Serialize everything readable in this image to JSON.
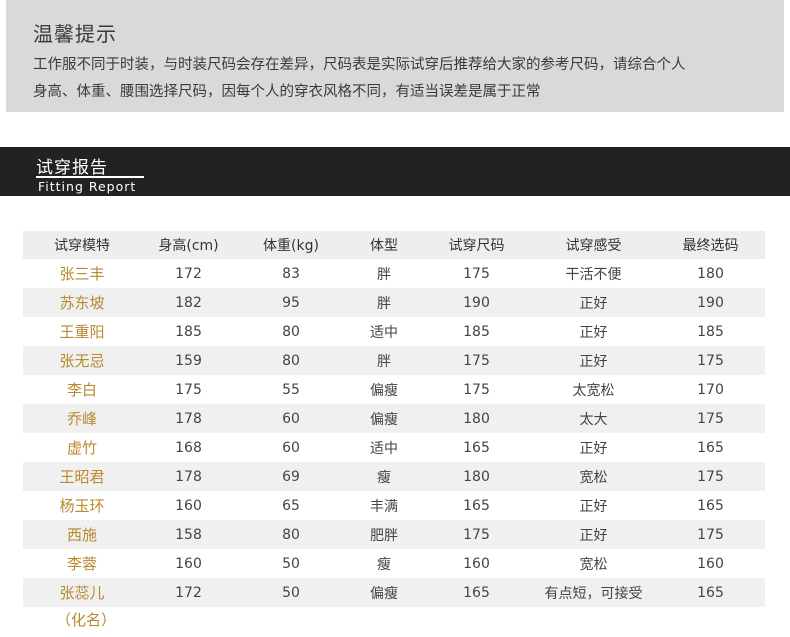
{
  "notice": {
    "title": "温馨提示",
    "line1": "工作服不同于时装，与时装尺码会存在差异，尺码表是实际试穿后推荐给大家的参考尺码，请综合个人",
    "line2": "身高、体重、腰围选择尺码，因每个人的穿衣风格不同，有适当误差是属于正常"
  },
  "banner": {
    "title_cn": "试穿报告",
    "title_en": "Fitting Report"
  },
  "table": {
    "headers": [
      "试穿模特",
      "身高(cm)",
      "体重(kg)",
      "体型",
      "试穿尺码",
      "试穿感受",
      "最终选码"
    ],
    "rows": [
      [
        "张三丰",
        "172",
        "83",
        "胖",
        "175",
        "干活不便",
        "180"
      ],
      [
        "苏东坡",
        "182",
        "95",
        "胖",
        "190",
        "正好",
        "190"
      ],
      [
        "王重阳",
        "185",
        "80",
        "适中",
        "185",
        "正好",
        "185"
      ],
      [
        "张无忌",
        "159",
        "80",
        "胖",
        "175",
        "正好",
        "175"
      ],
      [
        "李白",
        "175",
        "55",
        "偏瘦",
        "175",
        "太宽松",
        "170"
      ],
      [
        "乔峰",
        "178",
        "60",
        "偏瘦",
        "180",
        "太大",
        "175"
      ],
      [
        "虚竹",
        "168",
        "60",
        "适中",
        "165",
        "正好",
        "165"
      ],
      [
        "王昭君",
        "178",
        "69",
        "瘦",
        "180",
        "宽松",
        "175"
      ],
      [
        "杨玉环",
        "160",
        "65",
        "丰满",
        "165",
        "正好",
        "165"
      ],
      [
        "西施",
        "158",
        "80",
        "肥胖",
        "175",
        "正好",
        "175"
      ],
      [
        "李蓉",
        "160",
        "50",
        "瘦",
        "160",
        "宽松",
        "160"
      ],
      [
        "张蕊儿",
        "172",
        "50",
        "偏瘦",
        "165",
        "有点短，可接受",
        "165"
      ]
    ],
    "note": "（化名）"
  }
}
